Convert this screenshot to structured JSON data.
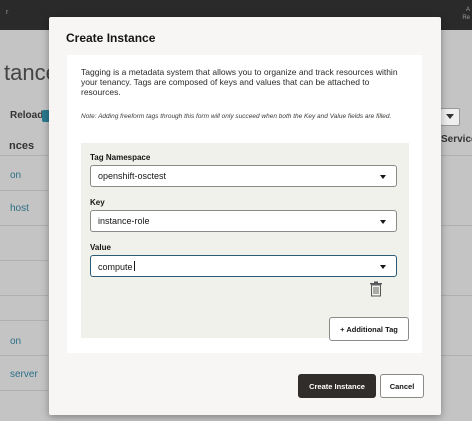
{
  "background": {
    "topbar_left": "r",
    "topbar_right_1": "A",
    "topbar_right_2": "Re",
    "page_title_fragment": "tance",
    "reload_label": "Reload",
    "table_header_fragment": "nces",
    "rows": [
      "on",
      "host",
      "on",
      "server"
    ],
    "service_header": "Service",
    "bottom_left": "...",
    "bottom_mid": "...",
    "bottom_right": "..."
  },
  "modal": {
    "title": "Create Instance",
    "description": "Tagging is a metadata system that allows you to organize and track resources within your tenancy. Tags are composed of keys and values that can be attached to resources.",
    "note": "Note: Adding freeform tags through this form will only succeed when both the Key and Value fields are filled.",
    "tag": {
      "namespace_label": "Tag Namespace",
      "namespace_value": "openshift-osctest",
      "key_label": "Key",
      "key_value": "instance-role",
      "value_label": "Value",
      "value_value": "compute"
    },
    "add_tag_label": "+ Additional Tag",
    "create_label": "Create Instance",
    "cancel_label": "Cancel"
  },
  "icons": {
    "dropdown": "chevron-down-icon",
    "delete": "trash-icon"
  }
}
